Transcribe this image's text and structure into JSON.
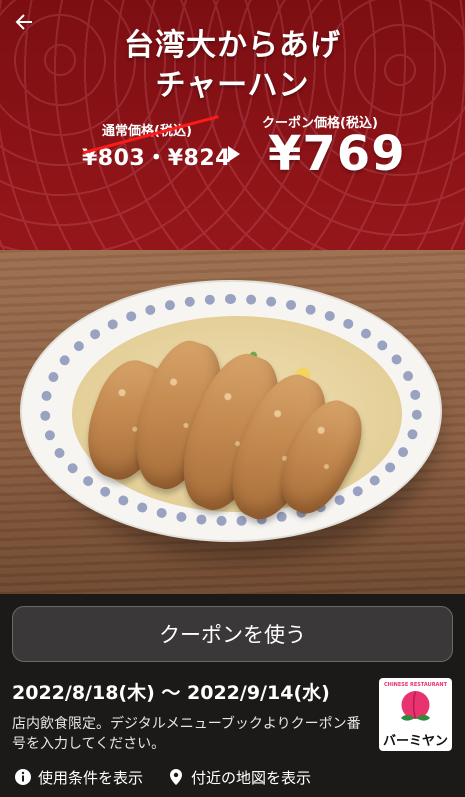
{
  "header": {
    "title_line1": "台湾大からあげ",
    "title_line2": "チャーハン",
    "back_icon": "arrow-left-icon"
  },
  "pricing": {
    "regular_label": "通常価格(税込)",
    "regular_price": "¥803・¥824",
    "coupon_label": "クーポン価格(税込)",
    "coupon_price": "¥769"
  },
  "actions": {
    "use_coupon_label": "クーポンを使う"
  },
  "validity": {
    "dates": "2022/8/18(木) 〜 2022/9/14(水)",
    "notice": "店内飲食限定。デジタルメニューブックよりクーポン番号を入力してください。"
  },
  "brand": {
    "logo_top_text": "CHINESE RESTAURANT",
    "logo_name": "バーミヤン",
    "logo_icon": "peach-logo-icon"
  },
  "links": [
    {
      "label": "使用条件を表示",
      "icon": "info-icon"
    },
    {
      "label": "付近の地図を表示",
      "icon": "location-pin-icon"
    }
  ],
  "colors": {
    "banner_red": "#a81d1d",
    "panel_bg": "#1c1a19",
    "strike_red": "#ff1a1a",
    "logo_pink": "#e8336f",
    "logo_green": "#2f8a3c"
  }
}
